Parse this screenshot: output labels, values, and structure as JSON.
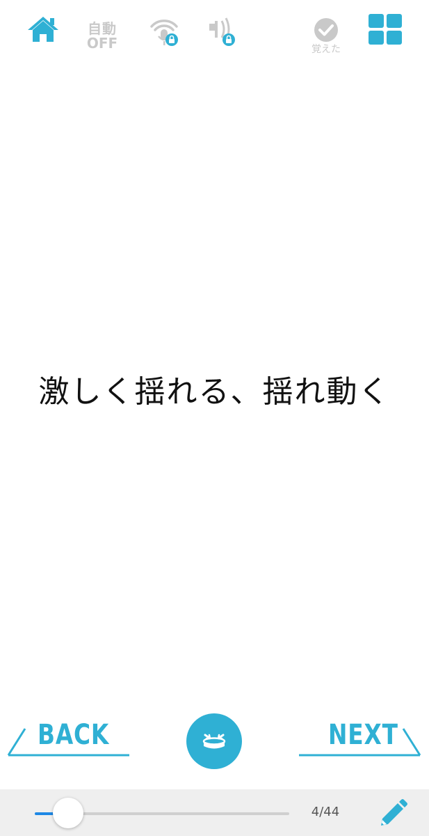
{
  "toolbar": {
    "auto_top": "自動",
    "auto_bottom": "OFF",
    "memorized_label": "覚えた",
    "icons": [
      "home-icon",
      "auto-play-icon",
      "mic-locked-icon",
      "sound-locked-icon",
      "check-circle-icon",
      "grid-icon"
    ]
  },
  "card": {
    "text": "激しく揺れる、揺れ動く"
  },
  "nav": {
    "back_label": "BACK",
    "next_label": "NEXT"
  },
  "progress": {
    "current": 4,
    "total": 44,
    "counter_text": "4/44"
  },
  "colors": {
    "accent": "#2fb0d4",
    "inactive": "#c9c9c9",
    "slider_active": "#1e88e5",
    "bottom_bar": "#efefef"
  }
}
